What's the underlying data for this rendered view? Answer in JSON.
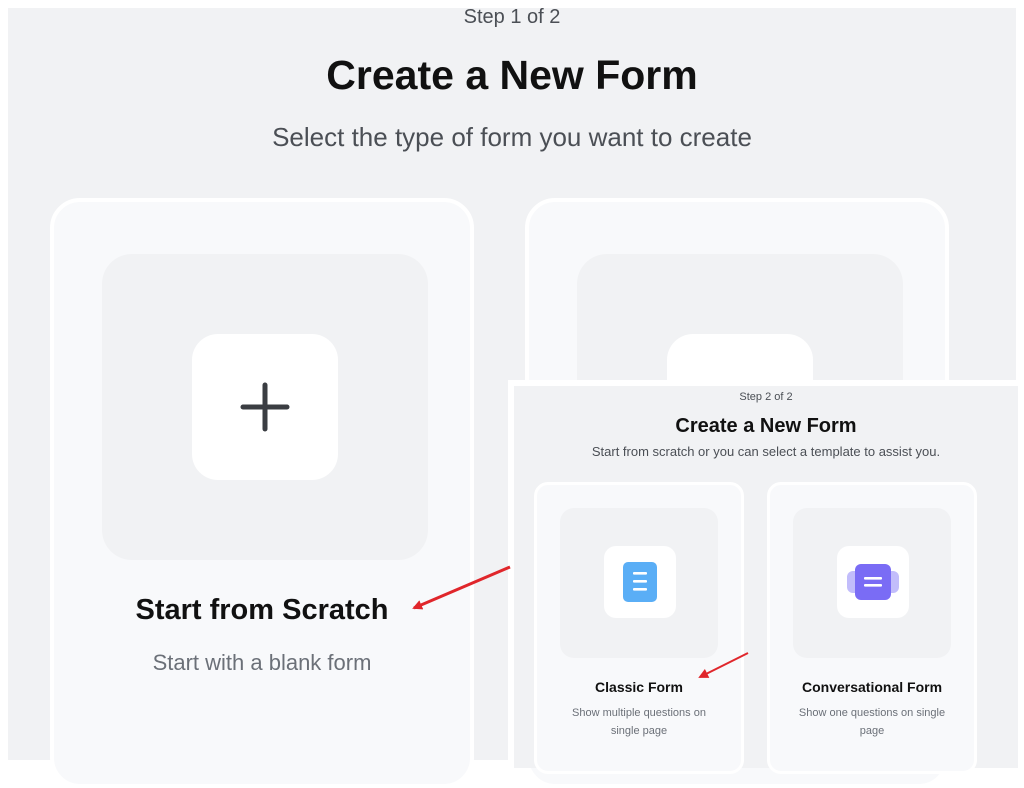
{
  "main": {
    "step": "Step 1 of 2",
    "title": "Create a New Form",
    "subtitle": "Select the type of form you want to create",
    "cards": [
      {
        "label": "Start from Scratch",
        "description": "Start with a blank form",
        "icon": "plus-icon"
      },
      {
        "label": "",
        "description": "",
        "icon": ""
      }
    ]
  },
  "overlay": {
    "step": "Step 2 of 2",
    "title": "Create a New Form",
    "subtitle": "Start from scratch or you can select a template to assist you.",
    "cards": [
      {
        "label": "Classic Form",
        "description": "Show multiple questions on single page",
        "icon": "document-list-icon",
        "icon_color": "#5aaef6"
      },
      {
        "label": "Conversational Form",
        "description": "Show one questions on single page",
        "icon": "chat-card-icon",
        "icon_color": "#7a6cf5"
      }
    ]
  },
  "annotation": {
    "arrow_color": "#e0262b"
  }
}
